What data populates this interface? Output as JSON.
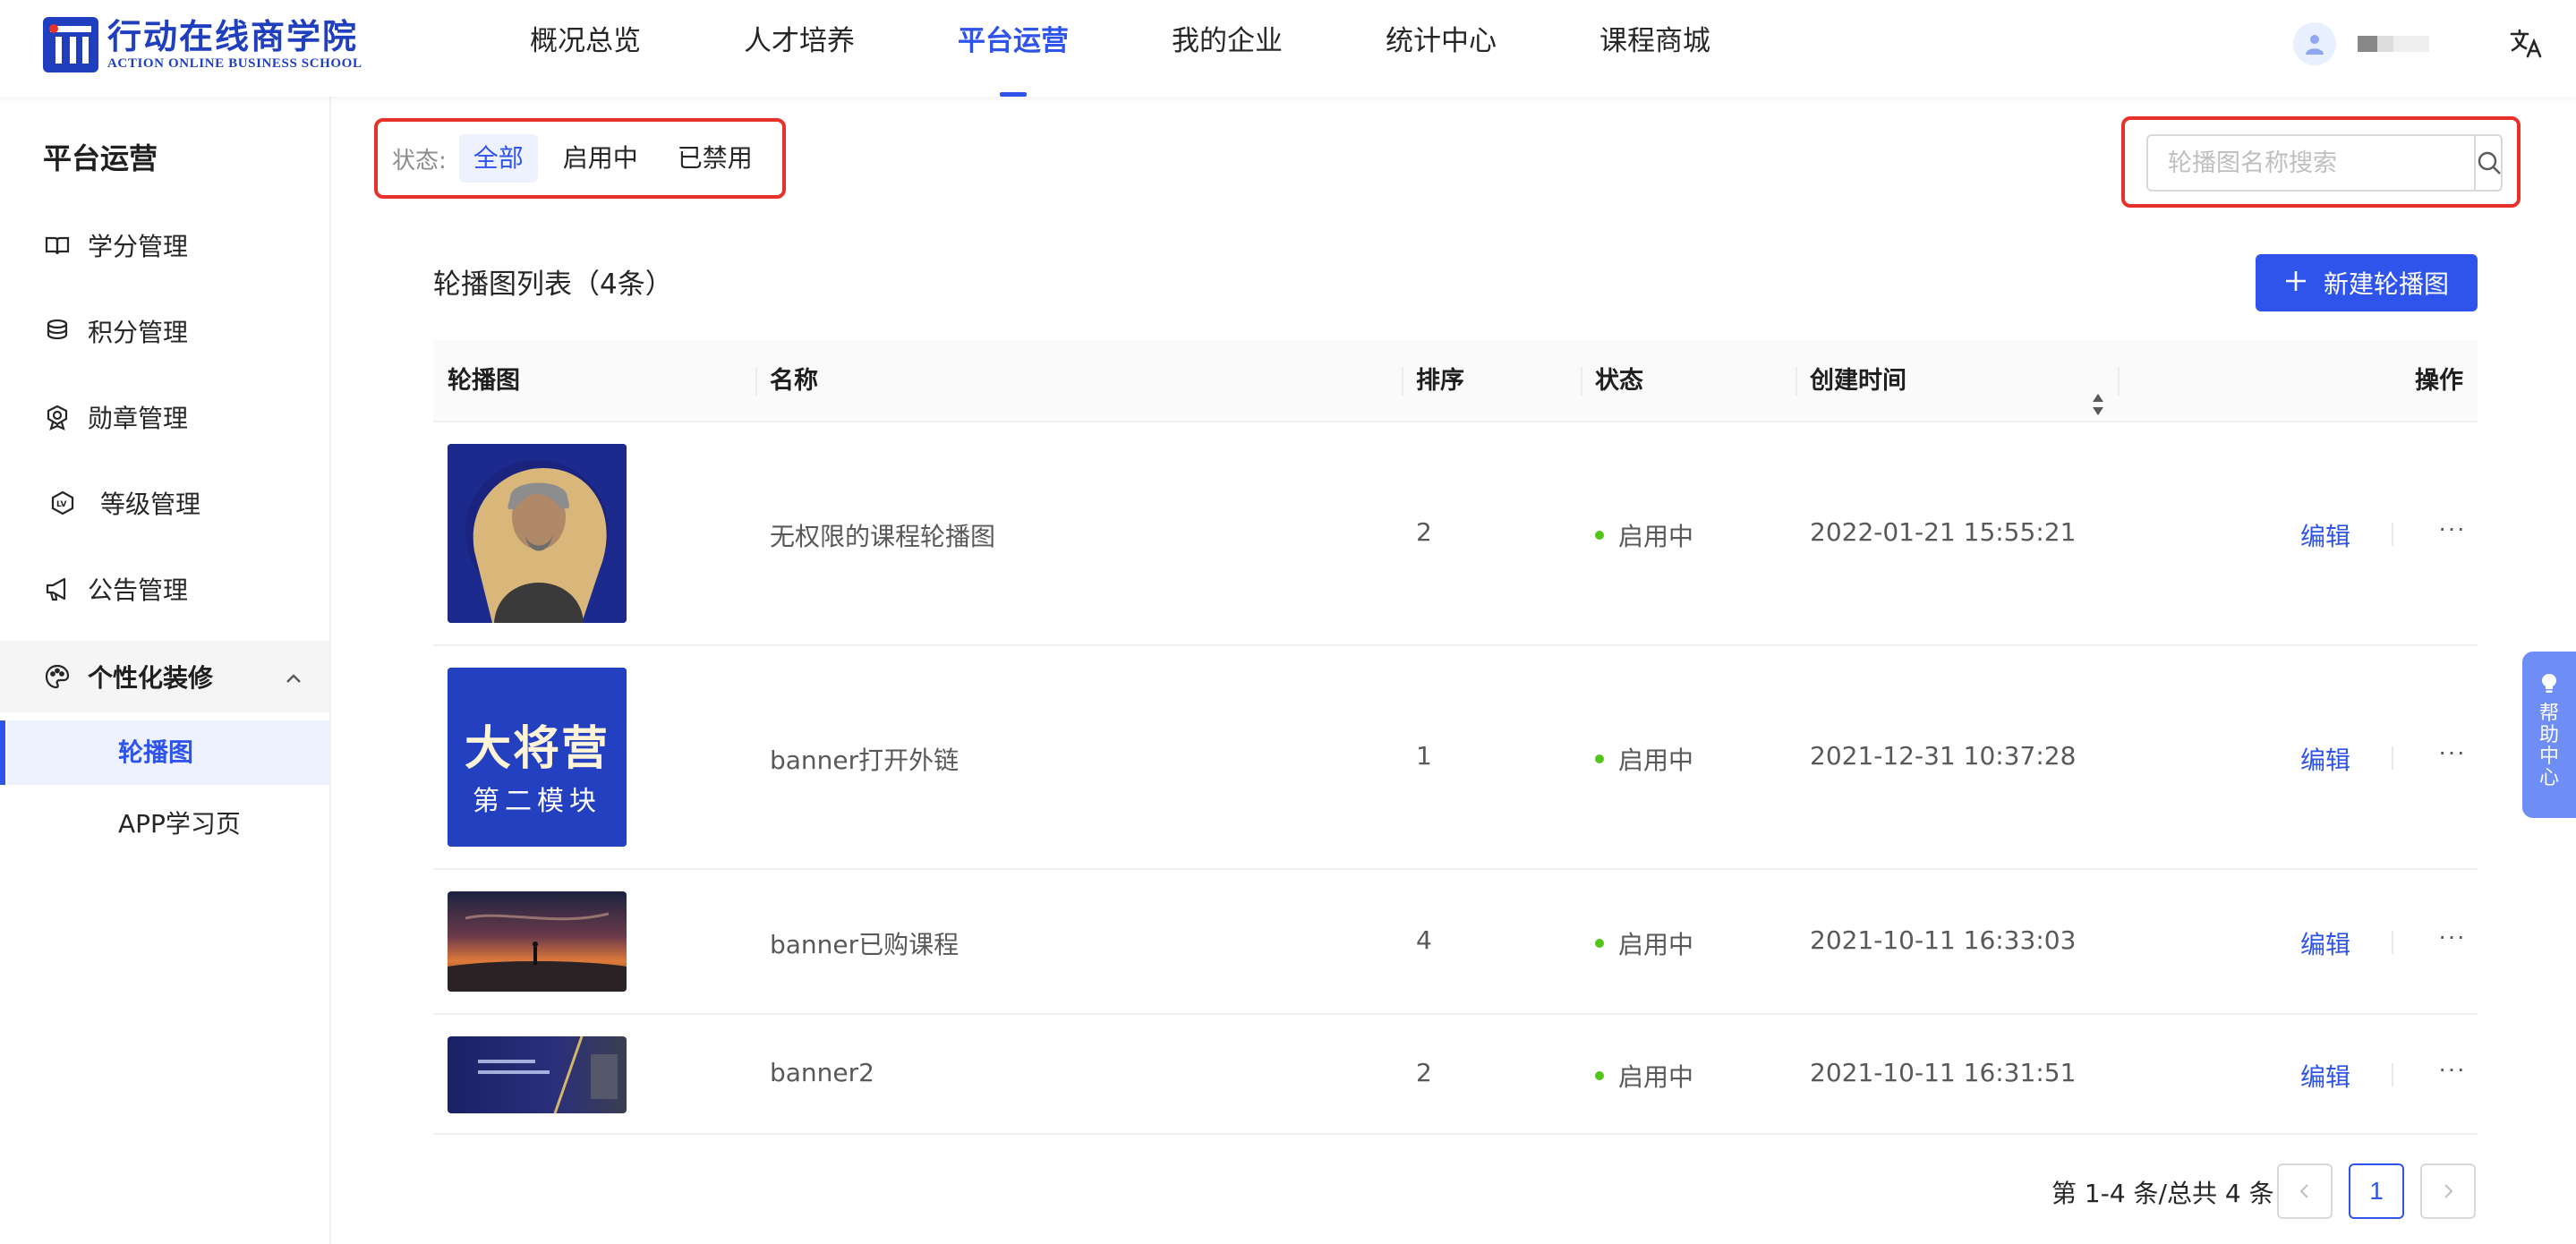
{
  "brand": {
    "name_cn": "行动在线商学院",
    "name_en": "ACTION ONLINE BUSINESS SCHOOL",
    "color": "#1f3fbf"
  },
  "nav": [
    {
      "label": "概况总览",
      "active": false
    },
    {
      "label": "人才培养",
      "active": false
    },
    {
      "label": "平台运营",
      "active": true
    },
    {
      "label": "我的企业",
      "active": false
    },
    {
      "label": "统计中心",
      "active": false
    },
    {
      "label": "课程商城",
      "active": false
    }
  ],
  "header_right": {
    "avatar_icon": "user-avatar-icon",
    "language_icon": "translate-icon"
  },
  "sidebar": {
    "title": "平台运营",
    "items": [
      {
        "label": "学分管理",
        "icon": "book-icon"
      },
      {
        "label": "积分管理",
        "icon": "coins-icon"
      },
      {
        "label": "勋章管理",
        "icon": "medal-icon"
      },
      {
        "label": "等级管理",
        "icon": "level-icon"
      },
      {
        "label": "公告管理",
        "icon": "megaphone-icon"
      }
    ],
    "group": {
      "label": "个性化装修",
      "icon": "palette-icon",
      "expanded": true,
      "children": [
        {
          "label": "轮播图",
          "active": true
        },
        {
          "label": "APP学习页",
          "active": false
        }
      ]
    }
  },
  "filter": {
    "label": "状态:",
    "options": [
      {
        "label": "全部",
        "active": true
      },
      {
        "label": "启用中",
        "active": false
      },
      {
        "label": "已禁用",
        "active": false
      }
    ]
  },
  "search": {
    "placeholder": "轮播图名称搜索",
    "value": ""
  },
  "list": {
    "title": "轮播图列表（4条）",
    "new_button": "新建轮播图",
    "columns": [
      "轮播图",
      "名称",
      "排序",
      "状态",
      "创建时间",
      "操作"
    ],
    "rows": [
      {
        "name": "无权限的课程轮播图",
        "order": "2",
        "status": "启用中",
        "created": "2022-01-21 15:55:21",
        "edit": "编辑",
        "more": "···",
        "thumb": {
          "kind": "portrait",
          "bg": "#1b2a8c"
        }
      },
      {
        "name": "banner打开外链",
        "order": "1",
        "status": "启用中",
        "created": "2021-12-31 10:37:28",
        "edit": "编辑",
        "more": "···",
        "thumb": {
          "kind": "text",
          "bg": "#2443c4",
          "line1": "大将营",
          "line2": "第二模块"
        }
      },
      {
        "name": "banner已购课程",
        "order": "4",
        "status": "启用中",
        "created": "2021-10-11 16:33:03",
        "edit": "编辑",
        "more": "···",
        "thumb": {
          "kind": "sunset",
          "bg": "#3a2a3e"
        }
      },
      {
        "name": "banner2",
        "order": "2",
        "status": "启用中",
        "created": "2021-10-11 16:31:51",
        "edit": "编辑",
        "more": "···",
        "thumb": {
          "kind": "dark",
          "bg": "#1a2050"
        }
      }
    ]
  },
  "pagination": {
    "summary": "第 1-4 条/总共 4 条",
    "current": "1",
    "prev": "<",
    "next": ">"
  },
  "help": {
    "label": "帮助中心",
    "icon": "lightbulb-icon"
  },
  "colors": {
    "primary": "#2f54eb",
    "highlight_border": "#e8312a",
    "status_active": "#52c41a"
  }
}
